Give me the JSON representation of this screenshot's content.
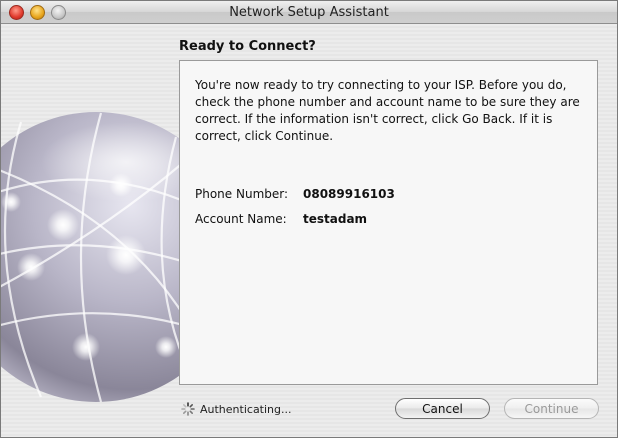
{
  "window": {
    "title": "Network Setup Assistant"
  },
  "page": {
    "heading": "Ready to Connect?",
    "description": "You're now ready to try connecting to your ISP. Before you do, check the phone number and account name to be sure they are correct. If the information isn't correct, click Go Back. If it is correct, click Continue.",
    "phone_label": "Phone Number:",
    "phone_value": "08089916103",
    "account_label": "Account Name:",
    "account_value": "testadam"
  },
  "status": {
    "text": "Authenticating...",
    "icon": "spinner-icon"
  },
  "buttons": {
    "cancel_label": "Cancel",
    "continue_label": "Continue",
    "continue_enabled": false
  },
  "colors": {
    "window_bg": "#ececec",
    "panel_bg": "#f7f7f7",
    "disabled_text": "#9a9a9a"
  }
}
